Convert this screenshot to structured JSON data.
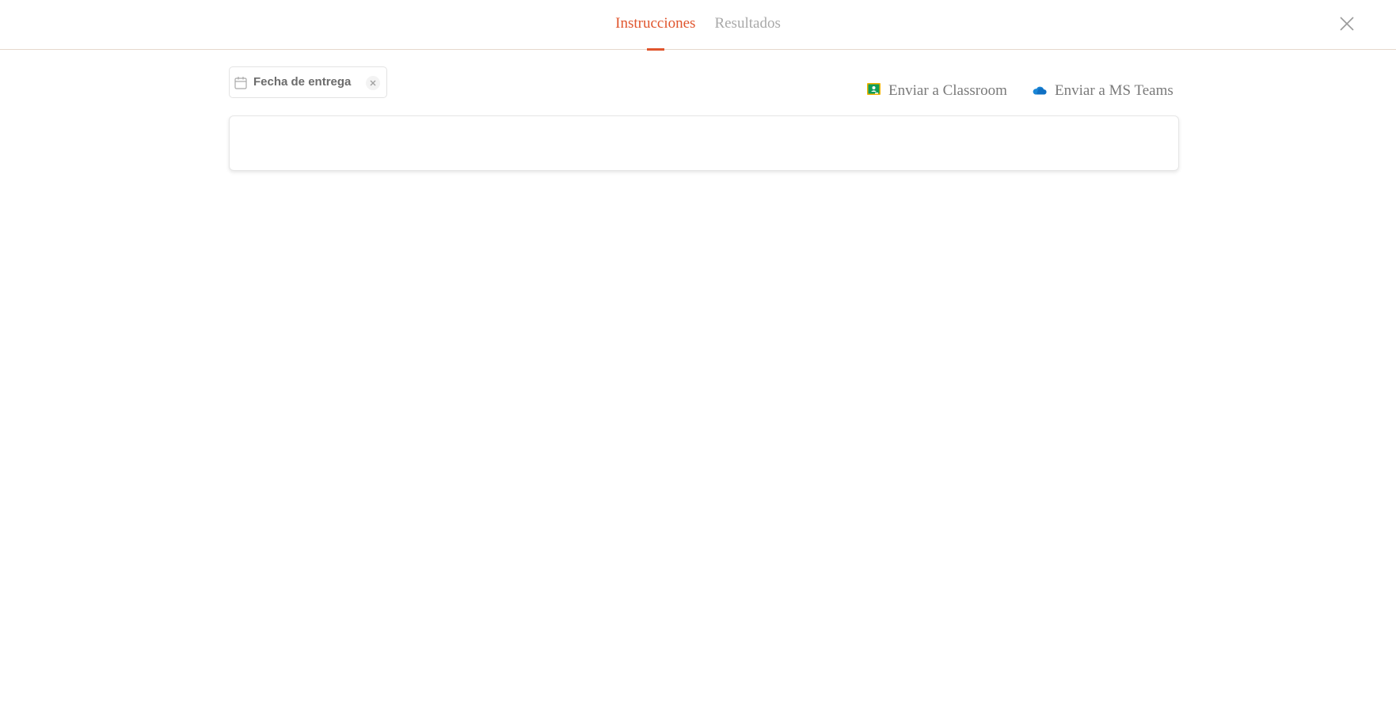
{
  "tabs": [
    {
      "label": "Instrucciones",
      "active": true
    },
    {
      "label": "Resultados",
      "active": false
    }
  ],
  "header": {
    "close_icon": "close-icon",
    "accent_color": "#e0552d"
  },
  "toolbar": {
    "due_date": {
      "label": "Fecha de entrega",
      "icon": "calendar-icon",
      "clear_icon": "clear-icon"
    },
    "send_classroom": {
      "label": "Enviar a Classroom",
      "icon": "google-classroom-icon"
    },
    "send_teams": {
      "label": "Enviar a MS Teams",
      "icon": "onedrive-cloud-icon"
    }
  },
  "content": {
    "text": ""
  }
}
